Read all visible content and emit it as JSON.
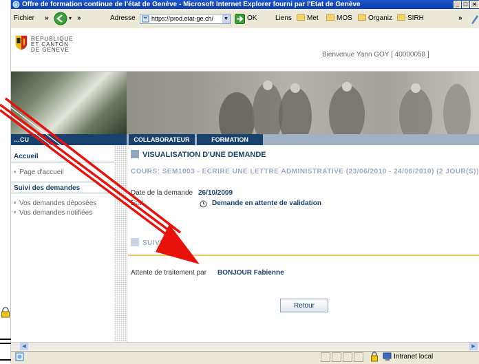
{
  "window": {
    "title": "Offre de formation continue de l'état de Genève - Microsoft Internet Explorer fourni par l'Etat de Genève"
  },
  "toolbar": {
    "file_menu": "Fichier",
    "chevron": "»",
    "back_arrow": "‹",
    "address_label": "Adresse",
    "address_value": "https://prod.etat-ge.ch/",
    "ok_label": "OK",
    "links_label": "Liens",
    "links": [
      "Met",
      "MOS",
      "Organiz",
      "SIRH"
    ]
  },
  "header": {
    "logo_lines": [
      "REPUBLIQUE",
      "ET CANTON",
      "DE GENEVE"
    ],
    "welcome": "Bienvenue Yann GOY [ 40000058 ]"
  },
  "nav": {
    "left_label": "…CU",
    "tabs": [
      "COLLABORATEUR",
      "FORMATION"
    ]
  },
  "sidebar": {
    "accueil": "Accueil",
    "page_accueil": "Page d'accueil",
    "suivi_demandes": "Suivi des demandes",
    "items": [
      "Vos demandes déposées",
      "Vos demandes notifiées"
    ]
  },
  "main": {
    "title": "VISUALISATION D'UNE DEMANDE",
    "cours": "COURS: SEM1003 - ECRIRE UNE LETTRE ADMINISTRATIVE (23/06/2010 - 24/06/2010) (2 JOUR(S))",
    "date_label": "Date de la demande",
    "date_value": "26/10/2009",
    "etat_label": "État",
    "etat_value": "Demande en attente de validation",
    "suivi_title": "SUIVI",
    "attente_label": "Attente de traitement par",
    "attente_value": "BONJOUR Fabienne",
    "retour_button": "Retour"
  },
  "statusbar": {
    "zone": "Intranet local"
  },
  "colors": {
    "accent": "#17426f",
    "arrow": "#e8120c",
    "gold_rule": "#e6c760"
  }
}
